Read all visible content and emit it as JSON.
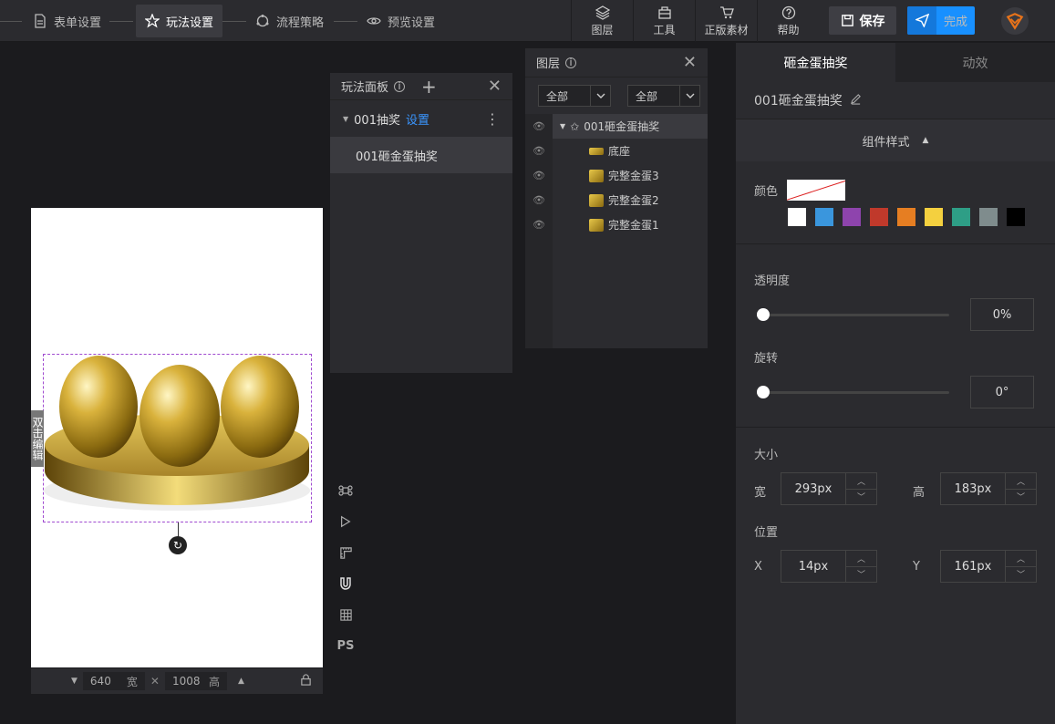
{
  "steps": [
    {
      "label": "表单设置",
      "icon": "document-icon"
    },
    {
      "label": "玩法设置",
      "icon": "star-icon"
    },
    {
      "label": "流程策略",
      "icon": "flow-icon"
    },
    {
      "label": "预览设置",
      "icon": "eye-icon"
    }
  ],
  "tools": [
    {
      "label": "图层",
      "icon": "layers-icon"
    },
    {
      "label": "工具",
      "icon": "toolbox-icon"
    },
    {
      "label": "正版素材",
      "icon": "cart-icon"
    },
    {
      "label": "帮助",
      "icon": "help-icon"
    }
  ],
  "actions": {
    "save": "保存",
    "done": "完成"
  },
  "canvas": {
    "width": "640",
    "width_unit": "宽",
    "height": "1008",
    "height_unit": "高",
    "double_click_tag": "双击编辑"
  },
  "side_tools": {
    "ps": "PS"
  },
  "play_panel": {
    "title": "玩法面板",
    "group": "001抽奖",
    "group_link": "设置",
    "item": "001砸金蛋抽奖"
  },
  "layer_panel": {
    "title": "图层",
    "filter1": "全部",
    "filter2": "全部",
    "layers": [
      {
        "name": "001砸金蛋抽奖"
      },
      {
        "name": "底座"
      },
      {
        "name": "完整金蛋3"
      },
      {
        "name": "完整金蛋2"
      },
      {
        "name": "完整金蛋1"
      }
    ]
  },
  "right_panel": {
    "tabs": [
      "砸金蛋抽奖",
      "动效"
    ],
    "title": "001砸金蛋抽奖",
    "section": "组件样式",
    "color_label": "颜色",
    "swatches": [
      "#ffffff",
      "#3a96dd",
      "#8e44ad",
      "#c0392b",
      "#e67e22",
      "#f4d03f",
      "#2e9e86",
      "#7f8c8d",
      "#000000"
    ],
    "opacity_label": "透明度",
    "opacity_value": "0%",
    "opacity_level": 0,
    "rotate_label": "旋转",
    "rotate_value": "0°",
    "size_label": "大小",
    "w_label": "宽",
    "w_value": "293px",
    "h_label": "高",
    "h_value": "183px",
    "pos_label": "位置",
    "x_label": "X",
    "x_value": "14px",
    "y_label": "Y",
    "y_value": "161px"
  }
}
